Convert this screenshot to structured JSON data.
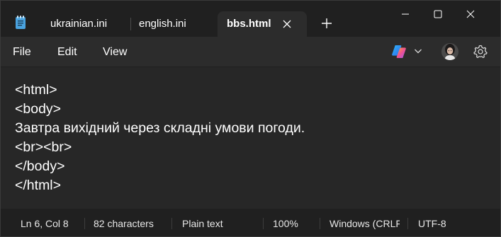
{
  "tabs": [
    {
      "label": "ukrainian.ini",
      "active": false
    },
    {
      "label": "english.ini",
      "active": false
    },
    {
      "label": "bbs.html",
      "active": true
    }
  ],
  "menu": {
    "file": "File",
    "edit": "Edit",
    "view": "View"
  },
  "editor": {
    "lines": [
      "<html>",
      "<body>",
      "Завтра вихідний через складні умови погоди.",
      "<br><br>",
      "</body>",
      "</html>"
    ]
  },
  "status": {
    "position": "Ln 6, Col 8",
    "characters": "82 characters",
    "format": "Plain text",
    "zoom": "100%",
    "line_ending": "Windows (CRLF)",
    "encoding": "UTF-8"
  },
  "icons": {
    "app": "notepad-icon",
    "tab_close": "close-icon",
    "new_tab": "plus-icon",
    "minimize": "minimize-icon",
    "maximize": "maximize-icon",
    "window_close": "close-icon",
    "copilot": "copilot-icon",
    "copilot_menu": "chevron-down-icon",
    "account": "avatar",
    "settings": "gear-icon"
  },
  "colors": {
    "titlebar_bg": "#202020",
    "active_tab_bg": "#2c2c2c",
    "menubar_bg": "#2c2c2c",
    "editor_bg": "#272727",
    "statusbar_bg": "#202020",
    "text": "#ffffff",
    "notepad_icon": "#4aa3df"
  }
}
